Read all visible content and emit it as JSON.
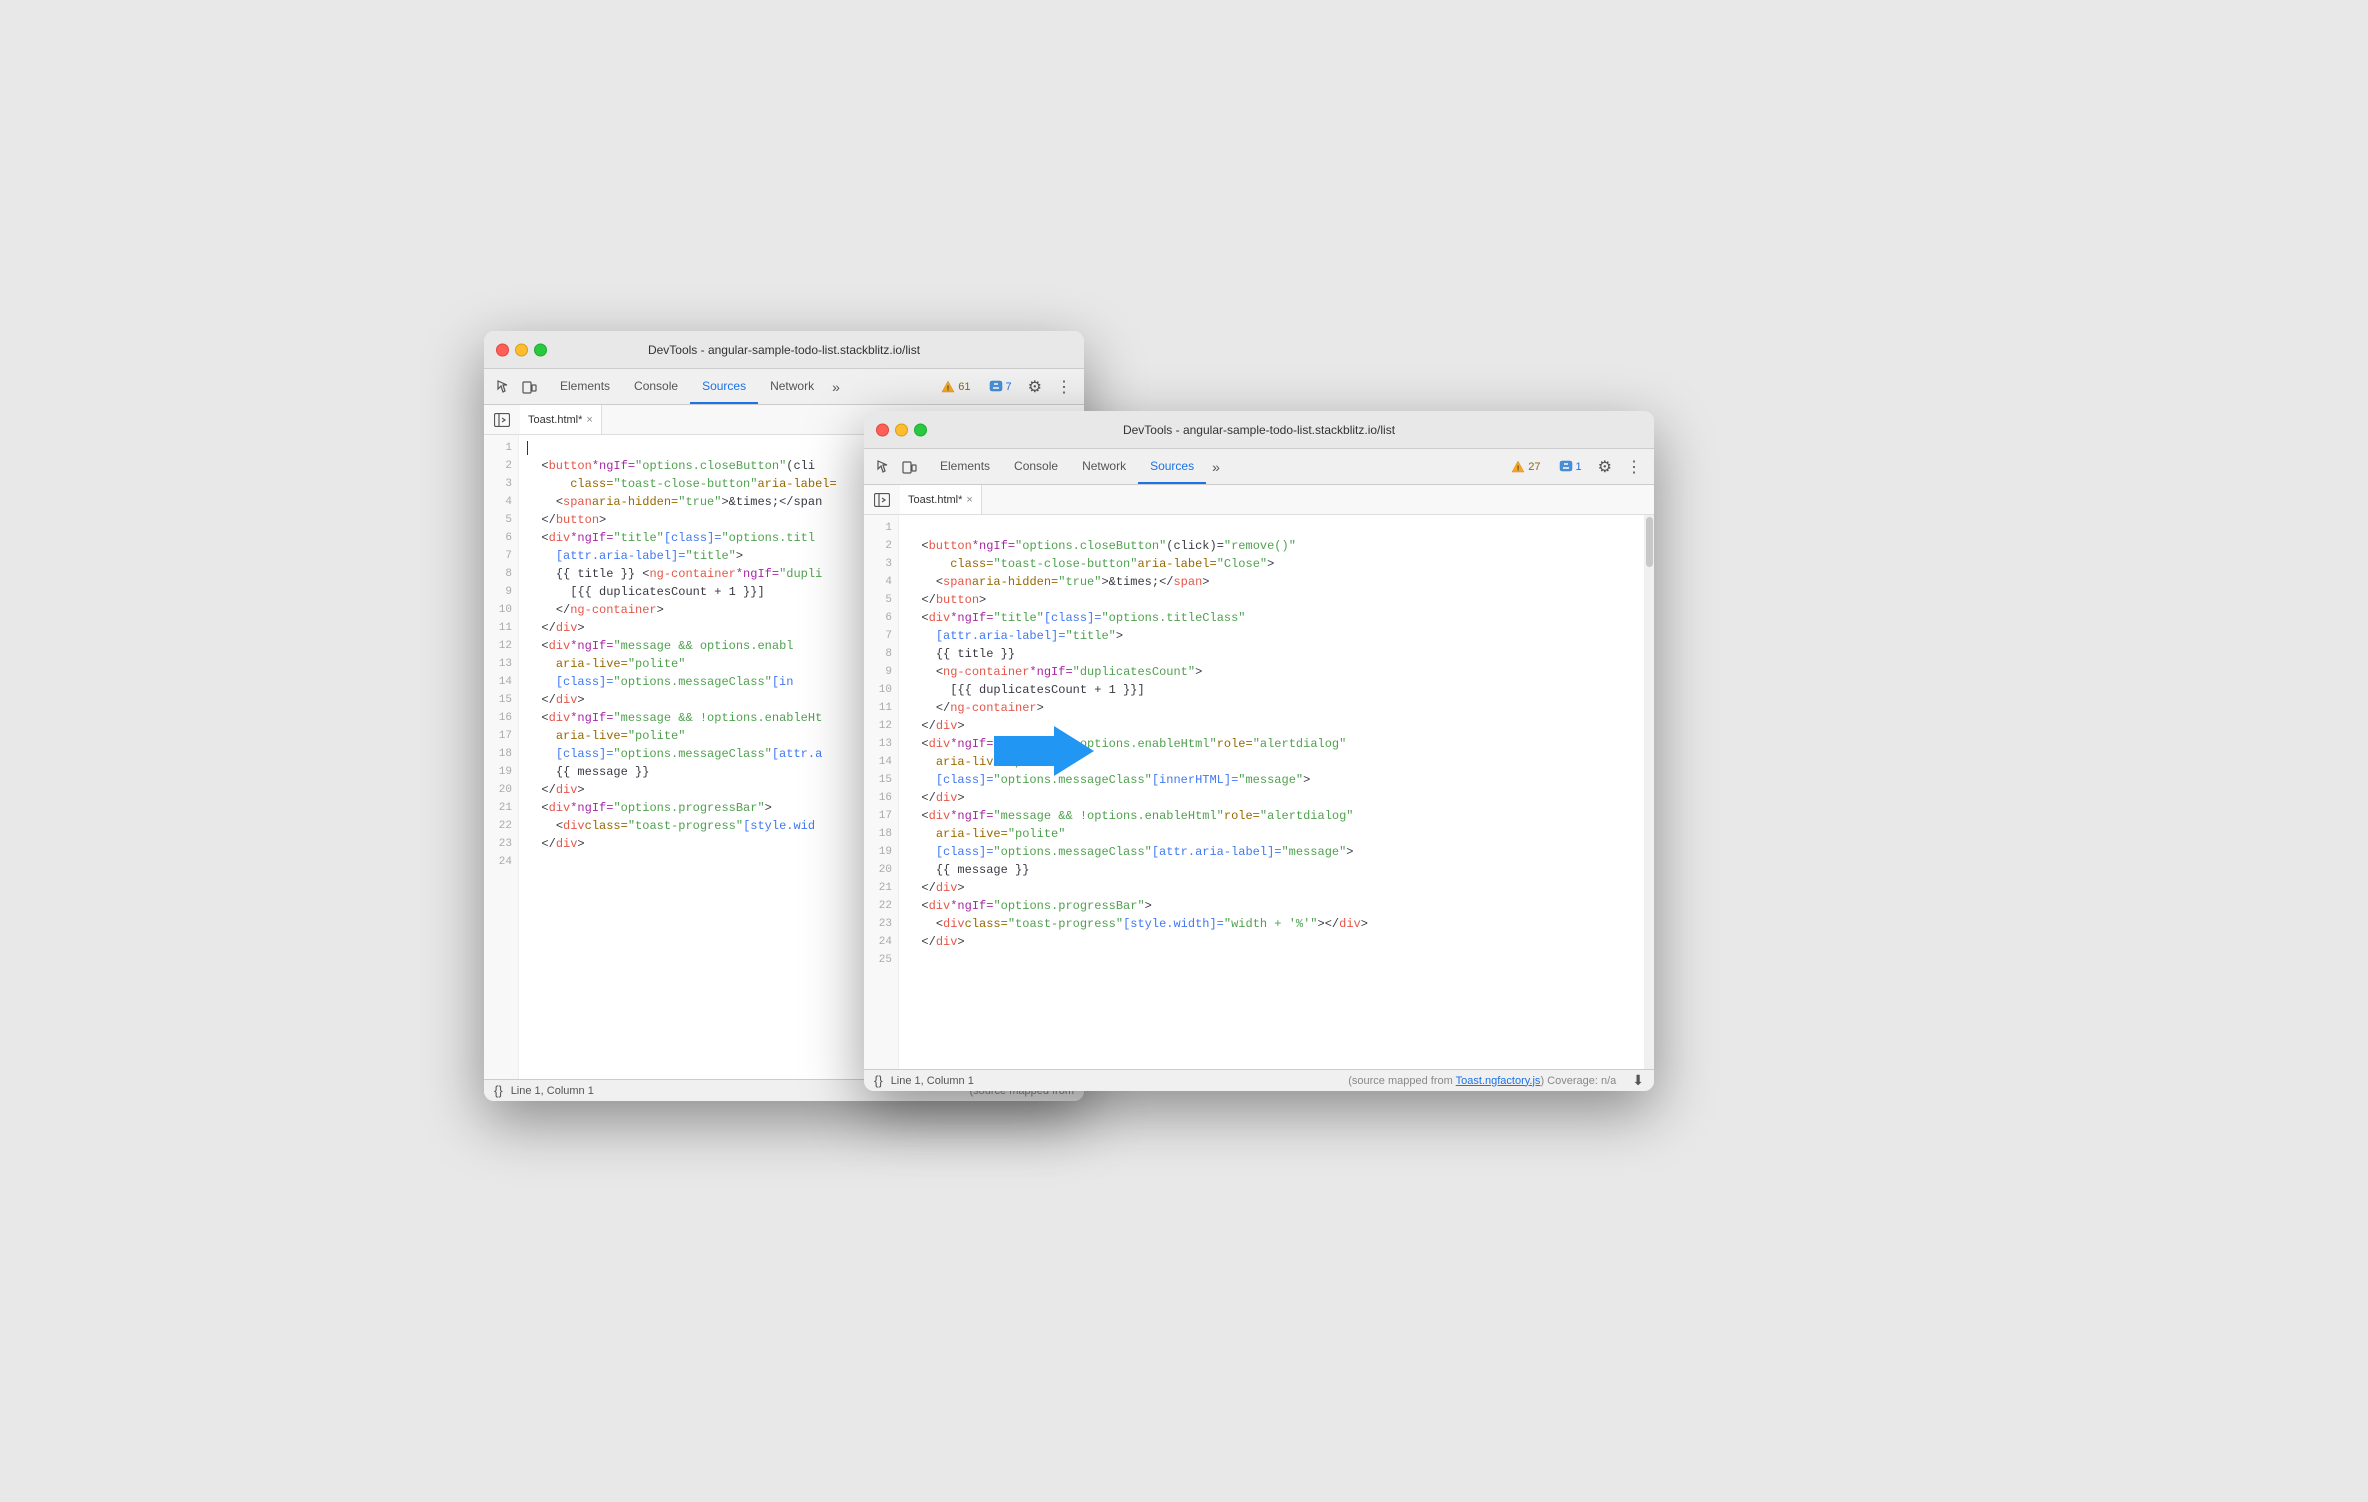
{
  "back_window": {
    "title": "DevTools - angular-sample-todo-list.stackblitz.io/list",
    "tabs": [
      "Elements",
      "Console",
      "Sources",
      "Network"
    ],
    "active_tab": "Sources",
    "file_tab": "Toast.html*",
    "badge_warning": "61",
    "badge_info": "7",
    "status_line": "Line 1, Column 1",
    "status_source": "(source mapped from",
    "code_lines": [
      {
        "num": 1,
        "content": "",
        "has_cursor": true
      },
      {
        "num": 2,
        "content": "  <button *ngIf=\"options.closeButton\" (cli"
      },
      {
        "num": 3,
        "content": "      class=\"toast-close-button\" aria-label="
      },
      {
        "num": 4,
        "content": "    <span aria-hidden=\"true\">&times;</span"
      },
      {
        "num": 5,
        "content": "  </button>"
      },
      {
        "num": 6,
        "content": "  <div *ngIf=\"title\" [class]=\"options.titl"
      },
      {
        "num": 7,
        "content": "    [attr.aria-label]=\"title\">"
      },
      {
        "num": 8,
        "content": "    {{ title }} <ng-container *ngIf=\"dupli"
      },
      {
        "num": 9,
        "content": "      [{{ duplicatesCount + 1 }}]"
      },
      {
        "num": 10,
        "content": "    </ng-container>"
      },
      {
        "num": 11,
        "content": "  </div>"
      },
      {
        "num": 12,
        "content": "  <div *ngIf=\"message && options.enabl"
      },
      {
        "num": 13,
        "content": "    aria-live=\"polite\""
      },
      {
        "num": 14,
        "content": "    [class]=\"options.messageClass\" [in"
      },
      {
        "num": 15,
        "content": "  </div>"
      },
      {
        "num": 16,
        "content": "  <div *ngIf=\"message && !options.enableHt"
      },
      {
        "num": 17,
        "content": "    aria-live=\"polite\""
      },
      {
        "num": 18,
        "content": "    [class]=\"options.messageClass\" [attr.a"
      },
      {
        "num": 19,
        "content": "    {{ message }}"
      },
      {
        "num": 20,
        "content": "  </div>"
      },
      {
        "num": 21,
        "content": "  <div *ngIf=\"options.progressBar\">"
      },
      {
        "num": 22,
        "content": "    <div class=\"toast-progress\" [style.wid"
      },
      {
        "num": 23,
        "content": "  </div>"
      },
      {
        "num": 24,
        "content": ""
      }
    ]
  },
  "front_window": {
    "title": "DevTools - angular-sample-todo-list.stackblitz.io/list",
    "tabs": [
      "Elements",
      "Console",
      "Network",
      "Sources"
    ],
    "active_tab": "Sources",
    "file_tab": "Toast.html*",
    "badge_warning": "27",
    "badge_info": "1",
    "status_line": "Line 1, Column 1",
    "status_source": "(source mapped from ",
    "status_source_link": "Toast.ngfactory.js",
    "status_coverage": ") Coverage: n/a",
    "code_lines": [
      {
        "num": 1,
        "content": ""
      },
      {
        "num": 2,
        "content": "  <button *ngIf=\"options.closeButton\" (click)=\"remove()\""
      },
      {
        "num": 3,
        "content": "      class=\"toast-close-button\" aria-label=\"Close\">"
      },
      {
        "num": 4,
        "content": "    <span aria-hidden=\"true\">&times;</span>"
      },
      {
        "num": 5,
        "content": "  </button>"
      },
      {
        "num": 6,
        "content": "  <div *ngIf=\"title\" [class]=\"options.titleClass\""
      },
      {
        "num": 7,
        "content": "    [attr.aria-label]=\"title\">"
      },
      {
        "num": 8,
        "content": "    {{ title }}"
      },
      {
        "num": 9,
        "content": "    <ng-container *ngIf=\"duplicatesCount\">"
      },
      {
        "num": 10,
        "content": "      [{{ duplicatesCount + 1 }}]"
      },
      {
        "num": 11,
        "content": "    </ng-container>"
      },
      {
        "num": 12,
        "content": "  </div>"
      },
      {
        "num": 13,
        "content": "  <div *ngIf=\"message && options.enableHtml\" role=\"alertdialog\""
      },
      {
        "num": 14,
        "content": "    aria-live=\"polite\""
      },
      {
        "num": 15,
        "content": "    [class]=\"options.messageClass\" [innerHTML]=\"message\">"
      },
      {
        "num": 16,
        "content": "  </div>"
      },
      {
        "num": 17,
        "content": "  <div *ngIf=\"message && !options.enableHtml\" role=\"alertdialog\""
      },
      {
        "num": 18,
        "content": "    aria-live=\"polite\""
      },
      {
        "num": 19,
        "content": "    [class]=\"options.messageClass\" [attr.aria-label]=\"message\">"
      },
      {
        "num": 20,
        "content": "    {{ message }}"
      },
      {
        "num": 21,
        "content": "  </div>"
      },
      {
        "num": 22,
        "content": "  <div *ngIf=\"options.progressBar\">"
      },
      {
        "num": 23,
        "content": "    <div class=\"toast-progress\" [style.width]=\"width + '%'\"></div>"
      },
      {
        "num": 24,
        "content": "  </div>"
      },
      {
        "num": 25,
        "content": ""
      }
    ]
  },
  "arrow": {
    "direction": "right",
    "color": "#2196F3"
  },
  "labels": {
    "elements": "Elements",
    "console": "Console",
    "sources": "Sources",
    "network": "Network",
    "more": "»",
    "gear": "⚙",
    "dots": "⋮",
    "warning_icon": "⚠",
    "info_icon": "💬"
  }
}
